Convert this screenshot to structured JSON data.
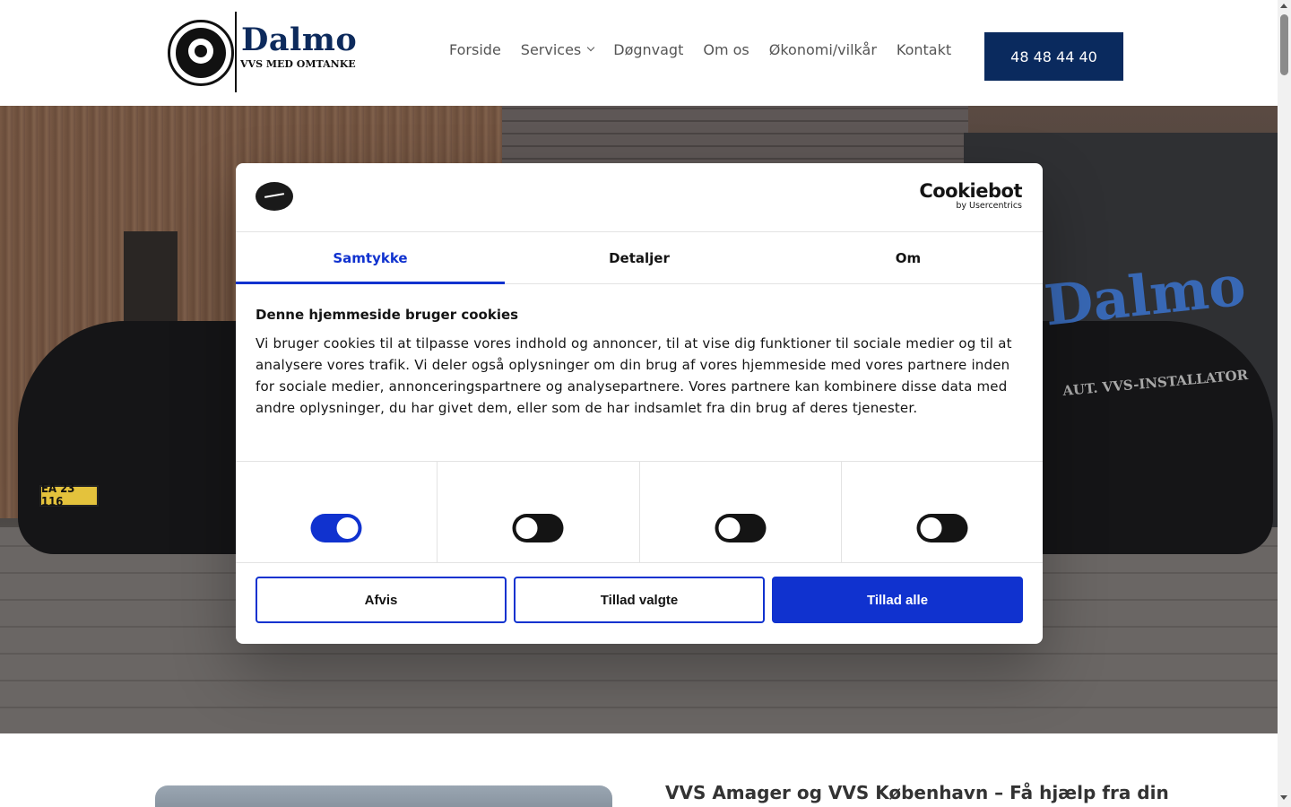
{
  "header": {
    "logo": {
      "name": "Dalmo",
      "tagline": "VVS MED OMTANKE"
    },
    "nav": [
      {
        "label": "Forside"
      },
      {
        "label": "Services",
        "has_dropdown": true
      },
      {
        "label": "Døgnvagt"
      },
      {
        "label": "Om os"
      },
      {
        "label": "Økonomi/vilkår"
      },
      {
        "label": "Kontakt"
      }
    ],
    "phone": "48 48 44 40"
  },
  "hero": {
    "van_brand": "Dalmo",
    "van_subtitle": "AUT. VVS-INSTALLATOR",
    "license_plate": "EA 23 116"
  },
  "cookie_dialog": {
    "brand": {
      "main": "Cookiebot",
      "sub": "by Usercentrics"
    },
    "tabs": [
      {
        "label": "Samtykke",
        "active": true
      },
      {
        "label": "Detaljer",
        "active": false
      },
      {
        "label": "Om",
        "active": false
      }
    ],
    "title": "Denne hjemmeside bruger cookies",
    "body": "Vi bruger cookies til at tilpasse vores indhold og annoncer, til at vise dig funktioner til sociale medier og til at analysere vores trafik. Vi deler også oplysninger om din brug af vores hjemmeside med vores partnere inden for sociale medier, annonceringspartnere og analysepartnere. Vores partnere kan kombinere disse data med andre oplysninger, du har givet dem, eller som de har indsamlet fra din brug af deres tjenester.",
    "toggles": [
      {
        "on": true
      },
      {
        "on": false
      },
      {
        "on": false
      },
      {
        "on": false
      }
    ],
    "buttons": {
      "reject": "Afvis",
      "allow_selected": "Tillad valgte",
      "allow_all": "Tillad alle"
    },
    "accent_color": "#1032cf"
  },
  "section": {
    "title": "VVS Amager og VVS København – Få hjælp fra din"
  }
}
